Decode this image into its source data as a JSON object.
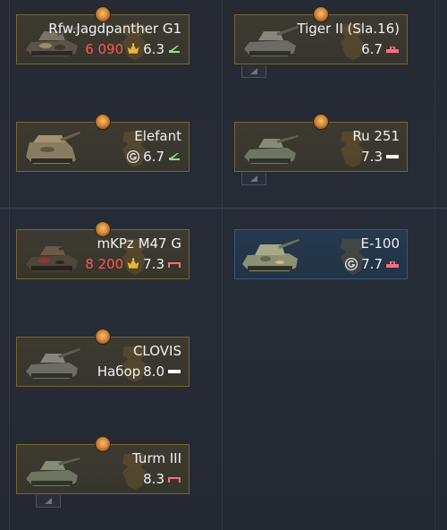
{
  "colors": {
    "card_border_gold": "#7a6530",
    "premium_border": "#35577a",
    "price_red": "#ff5a4a",
    "text": "#f1f1f1",
    "type_green": "#8de38a",
    "type_pink": "#ff6e7a",
    "type_white": "#ffffff"
  },
  "vehicles": [
    {
      "name": "Rfw.Jagdpanther G1",
      "price": "6 090",
      "br": "6.3",
      "type_icon": "tank-destroyer-icon"
    },
    {
      "name": "Tiger II (Sla.16)",
      "br": "6.7",
      "type_icon": "heavy-tank-icon"
    },
    {
      "name": "Elefant",
      "br": "6.7",
      "type_icon": "tank-destroyer-icon"
    },
    {
      "name": "Ru 251",
      "br": "7.3",
      "type_icon": "light-tank-icon"
    },
    {
      "name": "mKPz M47 G",
      "price": "8 200",
      "br": "7.3",
      "type_icon": "medium-tank-icon"
    },
    {
      "name": "E-100",
      "br": "7.7",
      "type_icon": "heavy-tank-icon"
    },
    {
      "name": "CLOVIS",
      "pack_label": "Набор",
      "br": "8.0",
      "type_icon": "light-tank-icon"
    },
    {
      "name": "Turm III",
      "br": "8.3",
      "type_icon": "medium-tank-icon"
    }
  ]
}
